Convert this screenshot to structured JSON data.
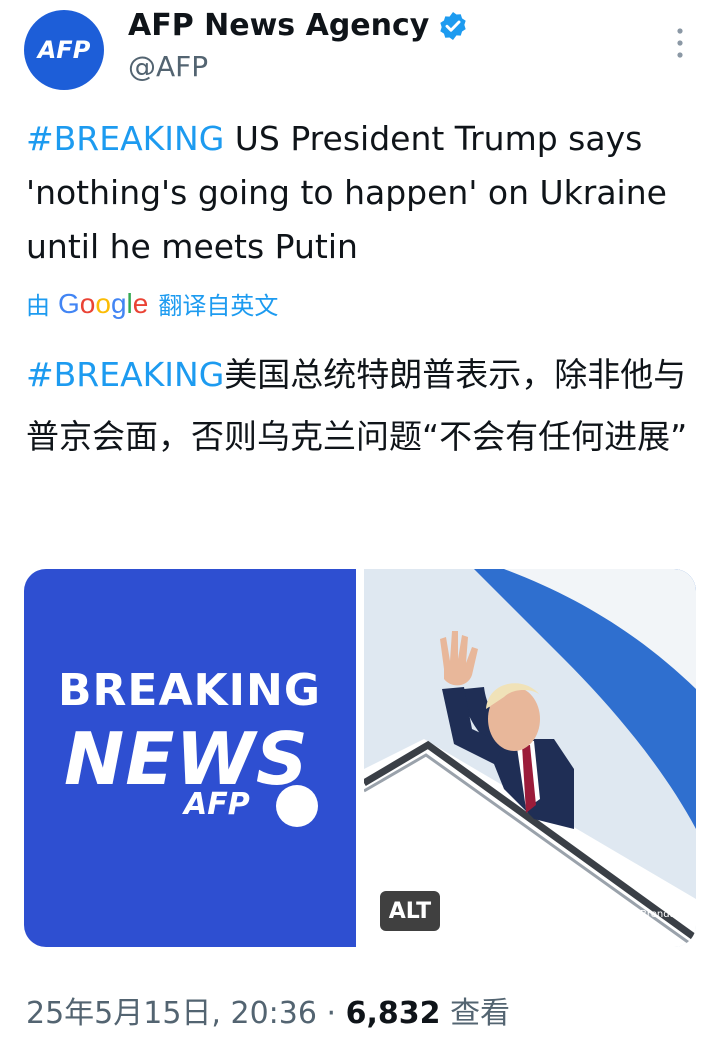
{
  "account": {
    "avatar_text": "AFP",
    "name": "AFP News Agency",
    "handle": "@AFP",
    "verified": true
  },
  "icons": {
    "verified": "verified-badge-icon",
    "more": "more-vertical-icon"
  },
  "tweet": {
    "hashtag": "#BREAKING",
    "text": " US President Trump says 'nothing's going to happen' on Ukraine until he meets Putin"
  },
  "translation": {
    "prefix": "由",
    "provider": "Google",
    "suffix": "翻译自英文",
    "hashtag": "#BREAKING",
    "text": "美国总统特朗普表示，除非他与普京会面，否则乌克兰问题“不会有任何进展”"
  },
  "media": {
    "left": {
      "line1": "BREAKING",
      "line2": "NEWS",
      "brand": "AFP"
    },
    "right": {
      "alt_label": "ALT",
      "credit": "Brendan S"
    }
  },
  "footer": {
    "timestamp": "25年5月15日, 20:36",
    "separator": "·",
    "views_count": "6,832",
    "views_label": "查看"
  },
  "colors": {
    "accent": "#1d9bf0",
    "avatar_bg": "#1d5ed8",
    "breaking_bg": "#2e4fd1",
    "text": "#0f1419",
    "muted": "#536471"
  }
}
